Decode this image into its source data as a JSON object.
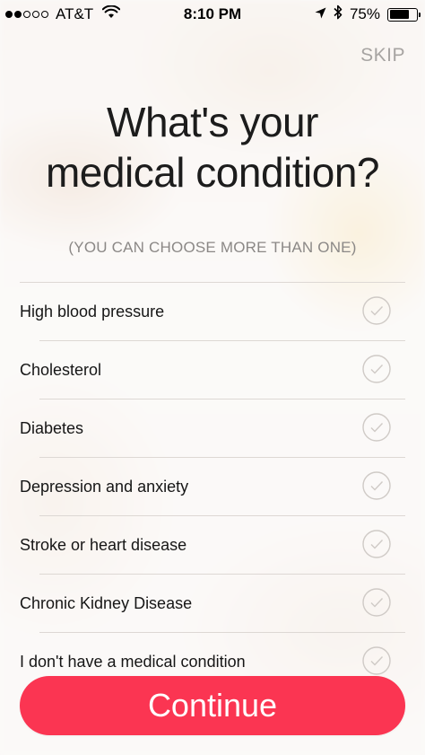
{
  "status_bar": {
    "carrier": "AT&T",
    "time": "8:10 PM",
    "battery": "75%",
    "battery_level": 0.75,
    "signal_bars_filled": 2,
    "signal_bars_total": 5
  },
  "header": {
    "skip_label": "SKIP",
    "title_line1": "What's your",
    "title_line2": "medical condition?",
    "subtitle": "(YOU CAN CHOOSE MORE THAN ONE)"
  },
  "conditions": [
    {
      "label": "High blood pressure",
      "checked": false
    },
    {
      "label": "Cholesterol",
      "checked": false
    },
    {
      "label": "Diabetes",
      "checked": false
    },
    {
      "label": "Depression and anxiety",
      "checked": false
    },
    {
      "label": "Stroke or heart disease",
      "checked": false
    },
    {
      "label": "Chronic Kidney Disease",
      "checked": false
    },
    {
      "label": "I don't have a medical condition",
      "checked": false
    }
  ],
  "footer": {
    "continue_label": "Continue"
  },
  "colors": {
    "accent": "#fb3552",
    "skip": "#a7a4a2",
    "check_circle": "#cfcac6"
  },
  "icons": {
    "wifi": "wifi-icon",
    "location": "location-arrow-icon",
    "bluetooth": "bluetooth-icon",
    "battery": "battery-icon",
    "checkmark": "checkmark-circle-icon"
  }
}
